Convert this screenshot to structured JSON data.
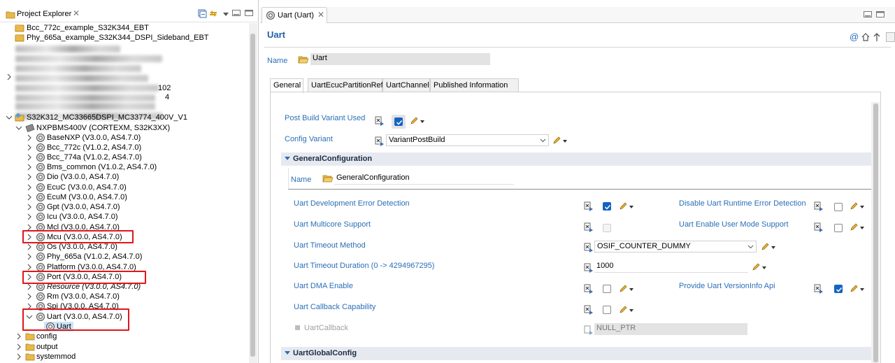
{
  "explorer": {
    "title": "Project Explorer",
    "items": [
      {
        "label": "Bcc_772c_example_S32K344_EBT"
      },
      {
        "label": "Phy_665a_example_S32K344_DSPI_Sideband_EBT"
      },
      {
        "label": "102"
      },
      {
        "label": "4"
      },
      {
        "label": "S32K312_MC33665DSPI_MC33774_400V_V1"
      },
      {
        "label": "NXPBMS400V (CORTEXM, S32K3XX)"
      },
      {
        "label": "BaseNXP (V3.0.0, AS4.7.0)"
      },
      {
        "label": "Bcc_772c (V1.0.2, AS4.7.0)"
      },
      {
        "label": "Bcc_774a (V1.0.2, AS4.7.0)"
      },
      {
        "label": "Bms_common (V1.0.2, AS4.7.0)"
      },
      {
        "label": "Dio (V3.0.0, AS4.7.0)"
      },
      {
        "label": "EcuC (V3.0.0, AS4.7.0)"
      },
      {
        "label": "EcuM (V3.0.0, AS4.7.0)"
      },
      {
        "label": "Gpt (V3.0.0, AS4.7.0)"
      },
      {
        "label": "Icu (V3.0.0, AS4.7.0)"
      },
      {
        "label": "Mcl (V3.0.0, AS4.7.0)"
      },
      {
        "label": "Mcu (V3.0.0, AS4.7.0)"
      },
      {
        "label": "Os (V3.0.0, AS4.7.0)"
      },
      {
        "label": "Phy_665a (V1.0.2, AS4.7.0)"
      },
      {
        "label": "Platform (V3.0.0, AS4.7.0)"
      },
      {
        "label": "Port (V3.0.0, AS4.7.0)"
      },
      {
        "label": "Resource (V3.0.0, AS4.7.0)"
      },
      {
        "label": "Rm (V3.0.0, AS4.7.0)"
      },
      {
        "label": "Spi (V3.0.0, AS4.7.0)"
      },
      {
        "label": "Uart (V3.0.0, AS4.7.0)"
      },
      {
        "label": "Uart"
      },
      {
        "label": "config"
      },
      {
        "label": "output"
      },
      {
        "label": "systemmod"
      }
    ]
  },
  "editor": {
    "tab_label": "Uart (Uart)",
    "heading": "Uart",
    "name_label": "Name",
    "name_value": "Uart",
    "subtabs": [
      "General",
      "UartEcucPartitionRef",
      "UartChannel",
      "Published Information"
    ],
    "post_build_label": "Post Build Variant Used",
    "config_variant_label": "Config Variant",
    "config_variant_value": "VariantPostBuild",
    "general_config": {
      "title": "GeneralConfiguration",
      "name_label": "Name",
      "name_value": "GeneralConfiguration"
    },
    "params": {
      "dev_error": "Uart Development Error Detection",
      "multicore": "Uart Multicore Support",
      "timeout_method": "Uart Timeout Method",
      "timeout_method_value": "OSIF_COUNTER_DUMMY",
      "timeout_duration": "Uart Timeout Duration (0 -> 4294967295)",
      "timeout_duration_value": "1000",
      "dma": "Uart DMA Enable",
      "callback_capability": "Uart Callback Capability",
      "callback": "UartCallback",
      "callback_value": "NULL_PTR",
      "disable_runtime": "Disable Uart Runtime Error Detection",
      "user_mode": "Uart Enable User Mode Support",
      "version_info": "Provide Uart VersionInfo Api"
    },
    "global_config_title": "UartGlobalConfig"
  }
}
